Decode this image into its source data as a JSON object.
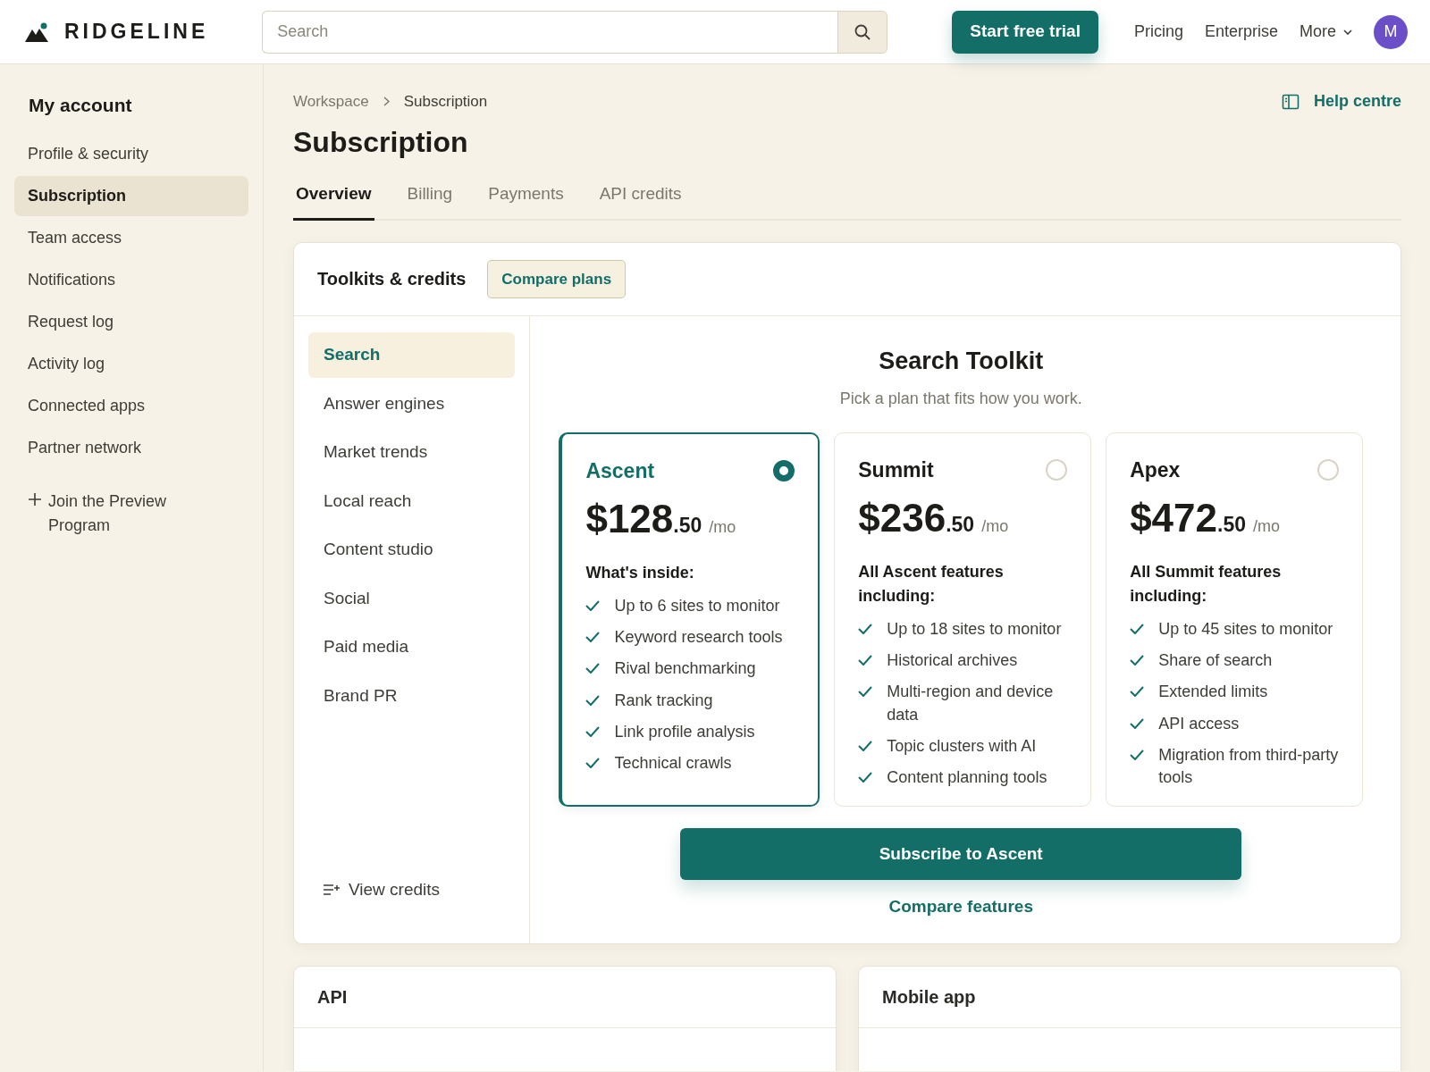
{
  "brand": {
    "name": "RIDGELINE"
  },
  "search": {
    "placeholder": "Search"
  },
  "header_actions": {
    "trial_button": "Start free trial",
    "links": [
      "Pricing",
      "Enterprise"
    ],
    "more": "More",
    "avatar": "M"
  },
  "sidebar": {
    "title": "My account",
    "items": [
      {
        "label": "Profile & security",
        "selected": false
      },
      {
        "label": "Subscription",
        "selected": true
      },
      {
        "label": "Team access",
        "selected": false
      },
      {
        "label": "Notifications",
        "selected": false
      },
      {
        "label": "Request log",
        "selected": false
      },
      {
        "label": "Activity log",
        "selected": false
      },
      {
        "label": "Connected apps",
        "selected": false
      },
      {
        "label": "Partner network",
        "selected": false
      }
    ],
    "join": "Join the Preview Program"
  },
  "breadcrumb": [
    "Workspace",
    "Subscription"
  ],
  "help_link": "Help centre",
  "page_title": "Subscription",
  "tabs": [
    {
      "label": "Overview",
      "selected": true
    },
    {
      "label": "Billing",
      "selected": false
    },
    {
      "label": "Payments",
      "selected": false
    },
    {
      "label": "API credits",
      "selected": false
    }
  ],
  "toolkits": {
    "title": "Toolkits & credits",
    "compare_button": "Compare plans",
    "menu": [
      {
        "label": "Search",
        "selected": true
      },
      {
        "label": "Answer engines",
        "selected": false
      },
      {
        "label": "Market trends",
        "selected": false
      },
      {
        "label": "Local reach",
        "selected": false
      },
      {
        "label": "Content studio",
        "selected": false
      },
      {
        "label": "Social",
        "selected": false
      },
      {
        "label": "Paid media",
        "selected": false
      },
      {
        "label": "Brand PR",
        "selected": false
      }
    ],
    "view_credits": "View credits",
    "heading": "Search Toolkit",
    "subtitle": "Pick a plan that fits how you work.",
    "plans": [
      {
        "name": "Ascent",
        "price": "$128",
        "cents": ".50",
        "period": "/mo",
        "selected": true,
        "intro": "What's inside:",
        "features": [
          "Up to 6 sites to monitor",
          "Keyword research tools",
          "Rival benchmarking",
          "Rank tracking",
          "Link profile analysis",
          "Technical crawls"
        ]
      },
      {
        "name": "Summit",
        "price": "$236",
        "cents": ".50",
        "period": "/mo",
        "selected": false,
        "intro": "All Ascent features including:",
        "features": [
          "Up to 18 sites to monitor",
          "Historical archives",
          "Multi-region and device data",
          "Topic clusters with AI",
          "Content planning tools"
        ]
      },
      {
        "name": "Apex",
        "price": "$472",
        "cents": ".50",
        "period": "/mo",
        "selected": false,
        "intro": "All Summit features including:",
        "features": [
          "Up to 45 sites to monitor",
          "Share of search",
          "Extended limits",
          "API access",
          "Migration from third-party tools"
        ]
      }
    ],
    "subscribe_button": "Subscribe to Ascent",
    "compare_link": "Compare features"
  },
  "bottom_cards": [
    {
      "title": "API"
    },
    {
      "title": "Mobile app"
    }
  ]
}
